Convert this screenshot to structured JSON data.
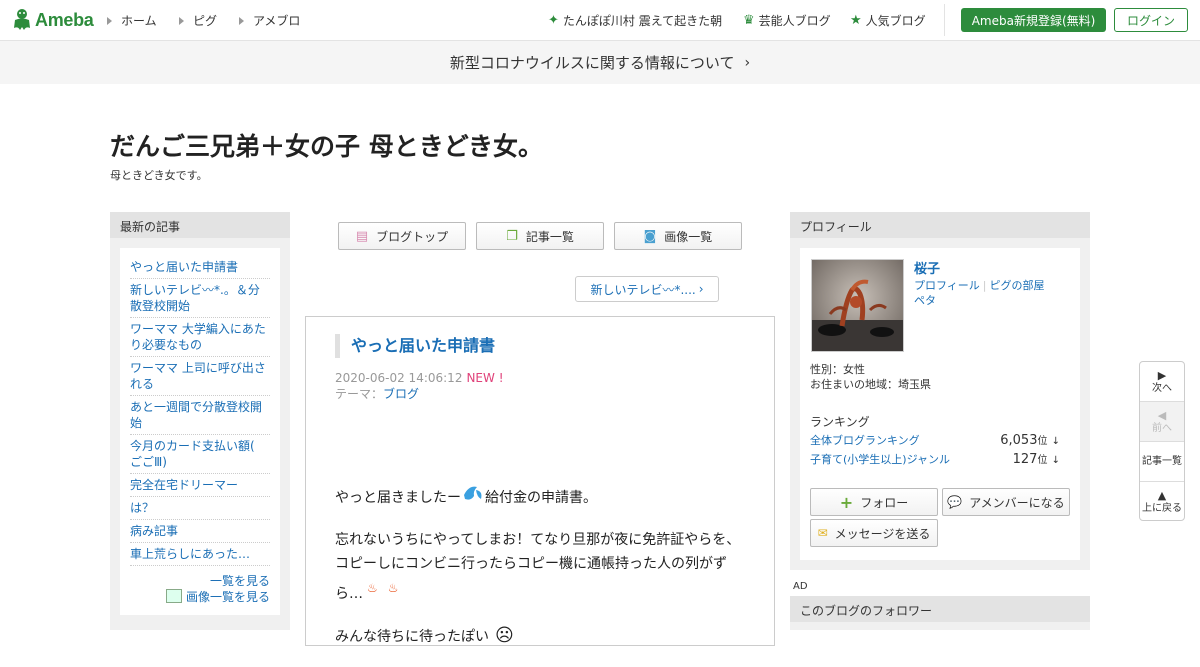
{
  "header": {
    "logo_text": "Ameba",
    "nav": [
      "ホーム",
      "ピグ",
      "アメブロ"
    ],
    "links": [
      {
        "label": "たんぽぽ川村 震えて起きた朝",
        "icon": "sparkle-icon"
      },
      {
        "label": "芸能人ブログ",
        "icon": "crown-icon"
      },
      {
        "label": "人気ブログ",
        "icon": "star-icon"
      }
    ],
    "register_label": "Ameba新規登録(無料)",
    "login_label": "ログイン",
    "accent": "#2d8c3c"
  },
  "banner": {
    "text": "新型コロナウイルスに関する情報について"
  },
  "blog": {
    "title": "だんご三兄弟＋女の子 母ときどき女。",
    "description": "母ときどき女です。"
  },
  "sidebar": {
    "heading": "最新の記事",
    "items": [
      "やっと届いた申請書",
      "新しいテレビ〰*.。＆分散登校開始",
      "ワーママ 大学編入にあたり必要なもの",
      "ワーママ 上司に呼び出される",
      "あと一週間で分散登校開始",
      "今月のカード支払い額( ごごⅢ)",
      "完全在宅ドリーマー",
      "は？",
      "病み記事",
      "車上荒らしにあった…"
    ],
    "see_all": "一覧を見る",
    "see_images": "画像一覧を見る"
  },
  "tabs": {
    "top": "ブログトップ",
    "list": "記事一覧",
    "images": "画像一覧"
  },
  "next_post": "新しいテレビ〰*....",
  "article": {
    "title": "やっと届いた申請書",
    "date": "2020-06-02 14:06:12",
    "new_badge": "NEW !",
    "theme_label": "テーマ：",
    "theme": "ブログ",
    "para1_a": "やっと届きましたー",
    "para1_b": "給付金の申請書。",
    "para2": "忘れないうちにやってしまお！てなり旦那が夜に免許証やらを、コピーしにコンビニ行ったらコピー機に通帳持った人の列がずら…",
    "para3": "みんな待ちに待ったぽい"
  },
  "profile": {
    "heading": "プロフィール",
    "name": "桜子",
    "link_profile": "プロフィール",
    "link_room": "ピグの部屋",
    "link_peta": "ペタ",
    "gender": "性別：女性",
    "location": "お住まいの地域：埼玉県",
    "ranking_title": "ランキング",
    "rankings": [
      {
        "label": "全体ブログランキング",
        "value": "6,053",
        "unit": "位",
        "arrow": "↓"
      },
      {
        "label": "子育て(小学生以上)ジャンル",
        "value": "127",
        "unit": "位",
        "arrow": "↓"
      }
    ],
    "follow_label": "フォロー",
    "amember_label": "アメンバーになる",
    "message_label": "メッセージを送る"
  },
  "ad_label": "AD",
  "followers_heading": "このブログのフォロワー",
  "sidenav": {
    "next": "次へ",
    "prev": "前へ",
    "list": "記事一覧",
    "top": "上に戻る"
  }
}
